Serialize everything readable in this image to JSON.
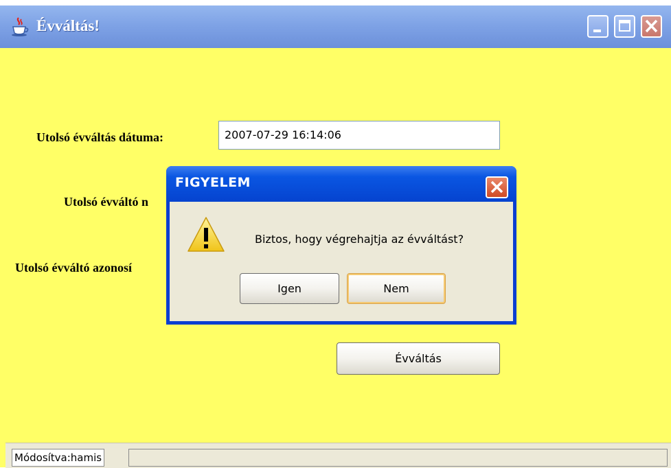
{
  "window": {
    "title": "Évváltás!",
    "controls": [
      "minimize-icon",
      "maximize-icon",
      "close-icon"
    ]
  },
  "form": {
    "last_date_label": "Utolsó évváltás dátuma:",
    "last_date_value": "2007-07-29 16:14:06",
    "last_user_label": "Utolsó évváltó n",
    "last_id_label": "Utolsó évváltó azonosí",
    "rollover_button": "Évváltás"
  },
  "statusbar": {
    "text": "Módosítva:hamis"
  },
  "dialog": {
    "title": "FIGYELEM",
    "message": "Biztos, hogy végrehajtja az évváltást?",
    "yes_button": "Igen",
    "no_button": "Nem"
  },
  "colors": {
    "window_background": "#ffff66",
    "titlebar": "#7fa3e6",
    "dialog_frame": "#0a3fd1",
    "dialog_body": "#ece9d8"
  }
}
